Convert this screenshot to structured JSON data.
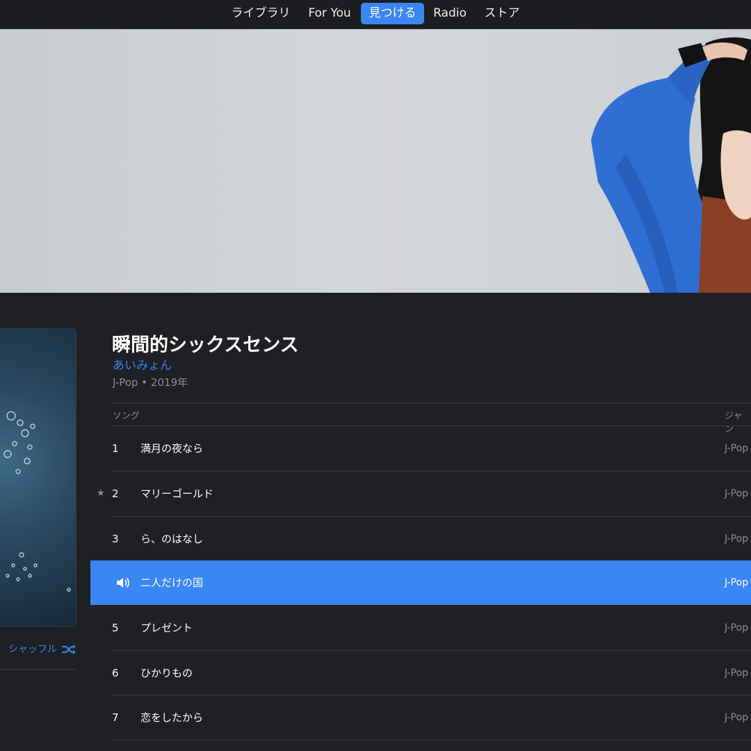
{
  "nav": {
    "tabs": [
      {
        "label": "ライブラリ"
      },
      {
        "label": "For You"
      },
      {
        "label": "見つける"
      },
      {
        "label": "Radio"
      },
      {
        "label": "ストア"
      }
    ],
    "active_tab": "見つける"
  },
  "album": {
    "title": "瞬間的シックスセンス",
    "artist": "あいみょん",
    "meta": "J-Pop • 2019年",
    "shuffle_label": "シャッフル"
  },
  "table": {
    "headers": {
      "song": "ソング",
      "genre": "ジャン"
    },
    "rows": [
      {
        "num": "1",
        "title": "満月の夜なら",
        "genre": "J-Pop",
        "star": "",
        "playing": false
      },
      {
        "num": "2",
        "title": "マリーゴールド",
        "genre": "J-Pop",
        "star": "★",
        "playing": false
      },
      {
        "num": "3",
        "title": "ら、のはなし",
        "genre": "J-Pop",
        "star": "",
        "playing": false
      },
      {
        "num": "",
        "title": "二人だけの国",
        "genre": "J-Pop",
        "star": "",
        "playing": true
      },
      {
        "num": "5",
        "title": "プレゼント",
        "genre": "J-Pop",
        "star": "",
        "playing": false
      },
      {
        "num": "6",
        "title": "ひかりもの",
        "genre": "J-Pop",
        "star": "",
        "playing": false
      },
      {
        "num": "7",
        "title": "恋をしたから",
        "genre": "J-Pop",
        "star": "",
        "playing": false
      }
    ]
  },
  "colors": {
    "accent": "#3a86f2",
    "background": "#1f2023",
    "secondary_text": "#8d8f94"
  }
}
